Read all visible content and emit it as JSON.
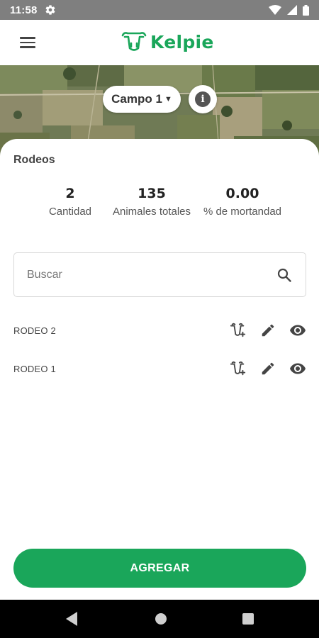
{
  "status_bar": {
    "time": "11:58"
  },
  "app": {
    "brand": "Kelpie"
  },
  "field_selector": {
    "value": "Campo 1"
  },
  "section": {
    "title": "Rodeos"
  },
  "stats": [
    {
      "value": "2",
      "label": "Cantidad"
    },
    {
      "value": "135",
      "label": "Animales totales"
    },
    {
      "value": "0.00",
      "label": "% de mortandad"
    }
  ],
  "search": {
    "placeholder": "Buscar"
  },
  "rodeos": [
    {
      "name": "RODEO 2"
    },
    {
      "name": "RODEO 1"
    }
  ],
  "actions": {
    "add_label": "AGREGAR"
  },
  "colors": {
    "brand": "#1aa65a",
    "status_bar": "#7f7f7f",
    "nav_bar": "#000000"
  }
}
